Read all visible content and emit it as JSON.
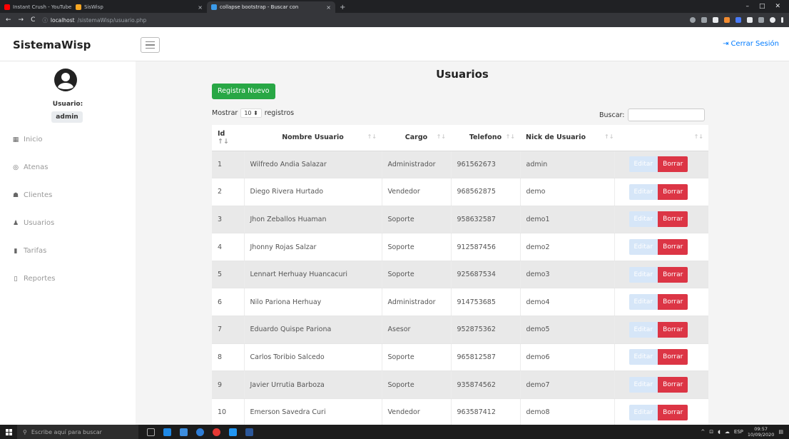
{
  "browser": {
    "tabs": [
      {
        "title": "Instant Crush - YouTube",
        "color": "#ff0000"
      },
      {
        "title": "SisWisp",
        "color": "#f5a623"
      },
      {
        "title": "collapse bootstrap - Buscar con",
        "color": "#3b9bea"
      }
    ],
    "url_host": "localhost",
    "url_path": "/sistemaWisp/usuario.php"
  },
  "app": {
    "brand": "SistemaWisp",
    "logout_label": "Cerrar Sesión"
  },
  "sidebar": {
    "user_label": "Usuario:",
    "username": "admin",
    "items": [
      {
        "label": "Inicio",
        "icon": "grid-icon"
      },
      {
        "label": "Atenas",
        "icon": "wifi-icon"
      },
      {
        "label": "Clientes",
        "icon": "users-icon"
      },
      {
        "label": "Usuarios",
        "icon": "user-icon"
      },
      {
        "label": "Tarifas",
        "icon": "file-icon"
      },
      {
        "label": "Reportes",
        "icon": "clipboard-icon"
      }
    ]
  },
  "main": {
    "title": "Usuarios",
    "new_button": "Registra Nuevo",
    "show_label": "Mostrar",
    "show_value": "10",
    "records_label": "registros",
    "search_label": "Buscar:",
    "search_value": "",
    "columns": [
      "Id",
      "Nombre Usuario",
      "Cargo",
      "Telefono",
      "Nick de Usuario",
      ""
    ],
    "edit_label": "Editar",
    "delete_label": "Borrar",
    "rows": [
      {
        "id": "1",
        "name": "Wilfredo Andia Salazar",
        "cargo": "Administrador",
        "tel": "961562673",
        "nick": "admin"
      },
      {
        "id": "2",
        "name": "Diego Rivera Hurtado",
        "cargo": "Vendedor",
        "tel": "968562875",
        "nick": "demo"
      },
      {
        "id": "3",
        "name": "Jhon Zeballos Huaman",
        "cargo": "Soporte",
        "tel": "958632587",
        "nick": "demo1"
      },
      {
        "id": "4",
        "name": "Jhonny Rojas Salzar",
        "cargo": "Soporte",
        "tel": "912587456",
        "nick": "demo2"
      },
      {
        "id": "5",
        "name": "Lennart Herhuay Huancacuri",
        "cargo": "Soporte",
        "tel": "925687534",
        "nick": "demo3"
      },
      {
        "id": "6",
        "name": "Nilo Pariona Herhuay",
        "cargo": "Administrador",
        "tel": "914753685",
        "nick": "demo4"
      },
      {
        "id": "7",
        "name": "Eduardo Quispe Pariona",
        "cargo": "Asesor",
        "tel": "952875362",
        "nick": "demo5"
      },
      {
        "id": "8",
        "name": "Carlos Toribio Salcedo",
        "cargo": "Soporte",
        "tel": "965812587",
        "nick": "demo6"
      },
      {
        "id": "9",
        "name": "Javier Urrutia Barboza",
        "cargo": "Soporte",
        "tel": "935874562",
        "nick": "demo7"
      },
      {
        "id": "10",
        "name": "Emerson Savedra Curi",
        "cargo": "Vendedor",
        "tel": "963587412",
        "nick": "demo8"
      }
    ]
  },
  "taskbar": {
    "search_placeholder": "Escribe aquí para buscar",
    "lang": "ESP",
    "time": "09:57",
    "date": "10/09/2020"
  },
  "colors": {
    "success": "#28a745",
    "danger": "#dc3545",
    "primary": "#007bff"
  }
}
